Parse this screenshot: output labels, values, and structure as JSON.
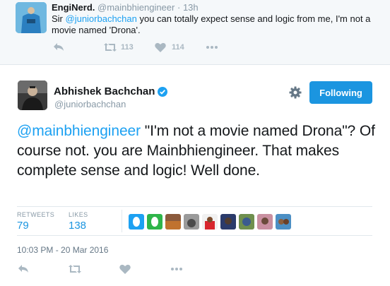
{
  "parent_tweet": {
    "name": "EngiNerd.",
    "handle": "@mainbhiengineer",
    "separator": "·",
    "time": "13h",
    "text_prefix": "Sir ",
    "mention": "@juniorbachchan",
    "text_suffix": " you can totally expect sense and logic from me, I'm not a movie named 'Drona'.",
    "retweet_count": "113",
    "like_count": "114",
    "icons": [
      "reply-icon",
      "retweet-icon",
      "heart-icon",
      "more-icon"
    ]
  },
  "main_tweet": {
    "name": "Abhishek Bachchan",
    "handle": "@juniorbachchan",
    "follow_label": "Following",
    "mention": "@mainbhiengineer",
    "text": " \"I'm not a movie named Drona\"? Of course not. you are Mainbhiengineer. That makes complete sense and logic! Well done.",
    "retweets_label": "RETWEETS",
    "retweets_value": "79",
    "likes_label": "LIKES",
    "likes_value": "138",
    "timestamp": "10:03 PM - 20 Mar 2016",
    "icons": [
      "verified-badge-icon",
      "gear-icon",
      "reply-icon",
      "retweet-icon",
      "heart-icon",
      "more-icon"
    ]
  },
  "colors": {
    "accent": "#1da1f2",
    "button": "#1b95e0",
    "muted": "#8899a6",
    "icon_gray": "#aab8c2",
    "parent_bg": "#f5f8fa"
  }
}
